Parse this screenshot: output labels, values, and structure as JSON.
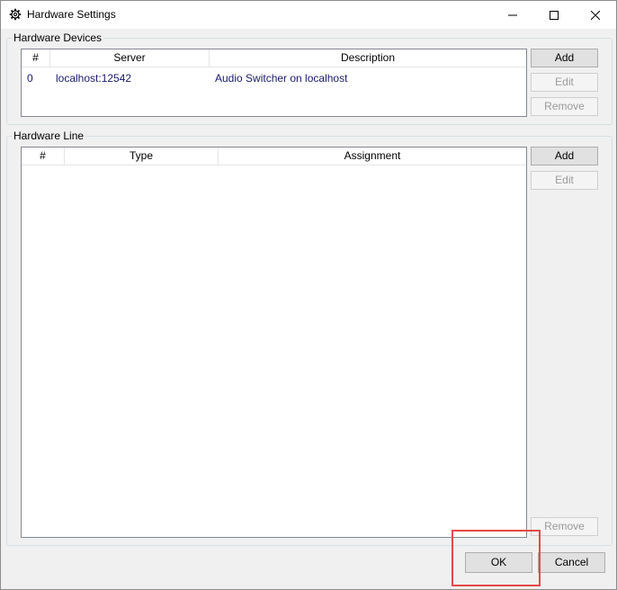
{
  "window": {
    "title": "Hardware Settings",
    "icon": "gear-icon",
    "controls": [
      "minimize-icon",
      "maximize-icon",
      "close-icon"
    ]
  },
  "hardware_devices": {
    "label": "Hardware Devices",
    "columns": [
      "#",
      "Server",
      "Description"
    ],
    "rows": [
      {
        "index": "0",
        "server": "localhost:12542",
        "description": "Audio Switcher on localhost"
      }
    ],
    "buttons": {
      "add": "Add",
      "edit": "Edit",
      "remove": "Remove"
    }
  },
  "hardware_line": {
    "label": "Hardware Line",
    "columns": [
      "#",
      "Type",
      "Assignment"
    ],
    "rows": [],
    "buttons": {
      "add": "Add",
      "edit": "Edit",
      "remove": "Remove"
    }
  },
  "footer": {
    "ok": "OK",
    "cancel": "Cancel"
  },
  "colors": {
    "highlight": "#e5484d",
    "row_text": "#1a1a6e"
  }
}
